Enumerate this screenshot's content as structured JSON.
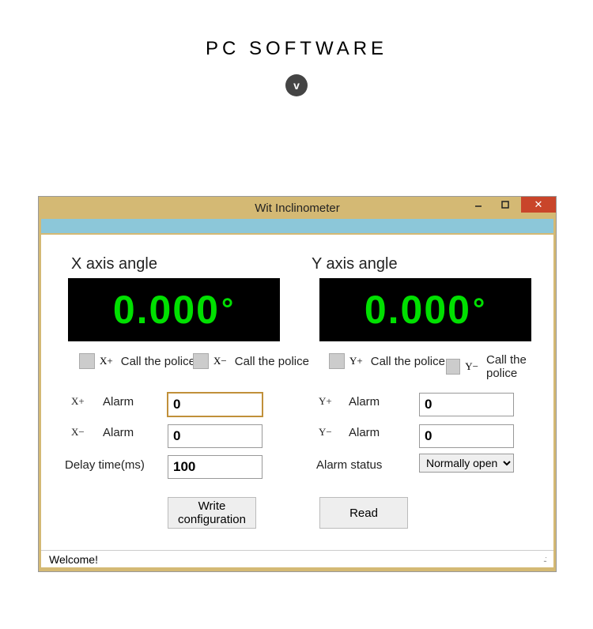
{
  "page": {
    "title": "PC  SOFTWARE",
    "badge": "v"
  },
  "window": {
    "title": "Wit Inclinometer",
    "close_glyph": "✕"
  },
  "axis": {
    "x_label": "X axis angle",
    "y_label": "Y axis angle",
    "x_value": "0.000",
    "y_value": "0.000",
    "deg": "°"
  },
  "police": {
    "label": "Call the police",
    "x_plus_prefix": "X+",
    "x_minus_prefix": "X−",
    "y_plus_prefix": "Y+",
    "y_minus_prefix": "Y−"
  },
  "fields": {
    "alarm_word": "Alarm",
    "x_plus_prefix": "X+",
    "x_minus_prefix": "X−",
    "y_plus_prefix": "Y+",
    "y_minus_prefix": "Y−",
    "x_plus_value": "0",
    "x_minus_value": "0",
    "y_plus_value": "0",
    "y_minus_value": "0",
    "delay_label": "Delay time(ms)",
    "delay_value": "100",
    "status_label": "Alarm status",
    "status_value": "Normally open"
  },
  "buttons": {
    "write": "Write configuration",
    "read": "Read"
  },
  "status": {
    "text": "Welcome!"
  }
}
